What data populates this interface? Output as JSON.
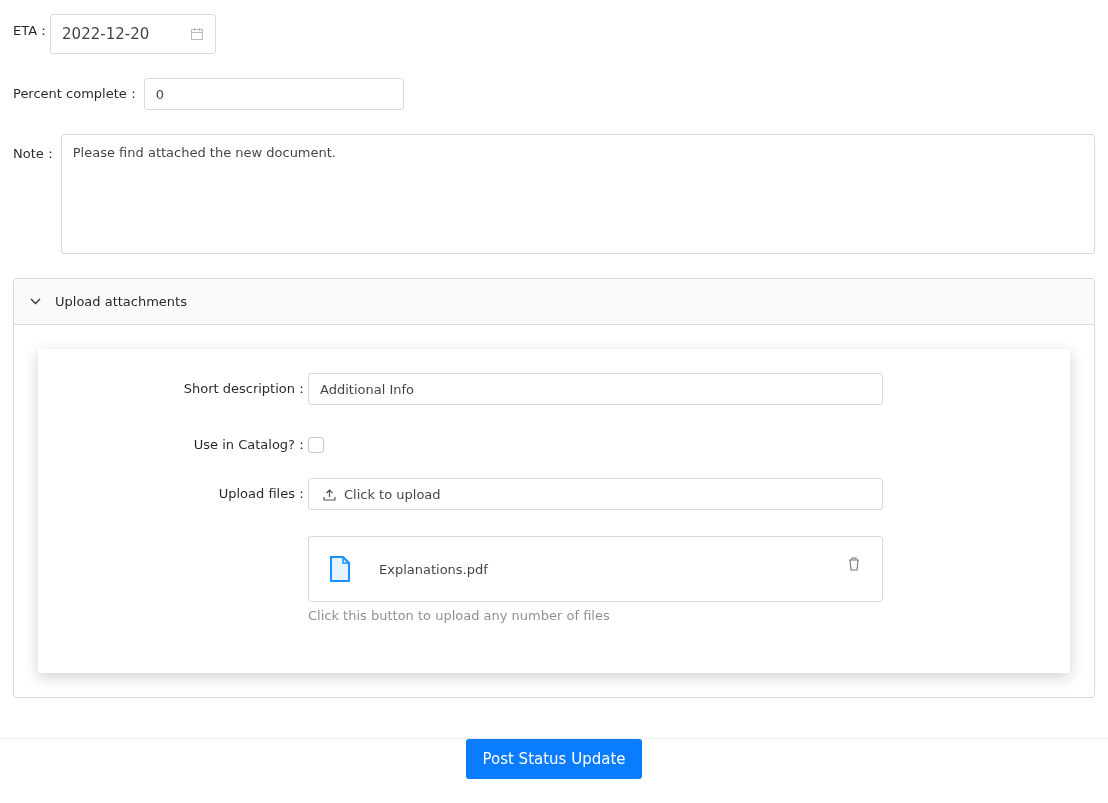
{
  "eta": {
    "label": "ETA：",
    "value": "2022-12-20"
  },
  "percent": {
    "label": "Percent complete：",
    "value": "0"
  },
  "note": {
    "label": "Note：",
    "value": "Please find attached the new document."
  },
  "attachments": {
    "title": "Upload attachments",
    "expanded": true,
    "short_description": {
      "label": "Short description：",
      "value": "Additional Info"
    },
    "catalog": {
      "label": "Use in Catalog?：",
      "checked": false
    },
    "upload": {
      "label": "Upload files：",
      "button": "Click to upload",
      "files": [
        {
          "name": "Explanations.pdf"
        }
      ],
      "hint": "Click this button to upload any number of files"
    }
  },
  "submit": "Post Status Update"
}
